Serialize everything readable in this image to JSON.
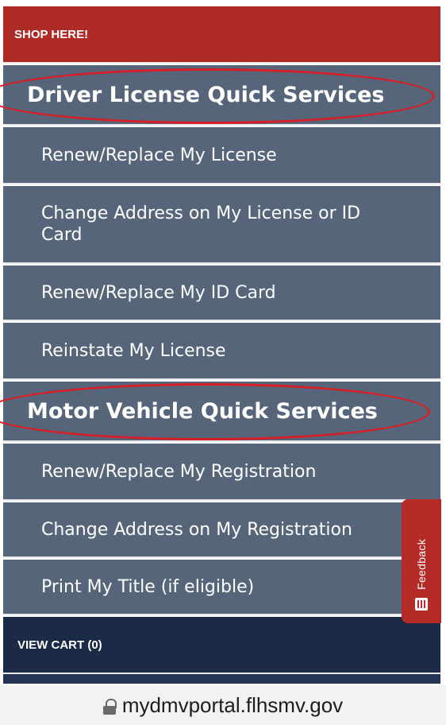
{
  "menu": {
    "shop_label": "SHOP HERE!",
    "driver_section": {
      "title": "Driver License Quick Services",
      "items": [
        "Renew/Replace My License",
        "Change Address on My License or ID Card",
        "Renew/Replace My ID Card",
        "Reinstate My License"
      ]
    },
    "vehicle_section": {
      "title": "Motor Vehicle Quick Services",
      "items": [
        "Renew/Replace My Registration",
        "Change Address on My Registration",
        "Print My Title (if eligible)"
      ]
    },
    "cart_label": "VIEW CART (0)"
  },
  "feedback": {
    "label": "Feedback",
    "icon": "list-icon"
  },
  "browser": {
    "url": "mydmvportal.flhsmv.gov",
    "icon": "lock-icon"
  },
  "colors": {
    "shop_bg": "#ad2a27",
    "menu_bg": "#56657a",
    "cart_bg": "#1b2a47",
    "highlight_oval": "#d61f26",
    "feedback_bg": "#b52b28"
  }
}
